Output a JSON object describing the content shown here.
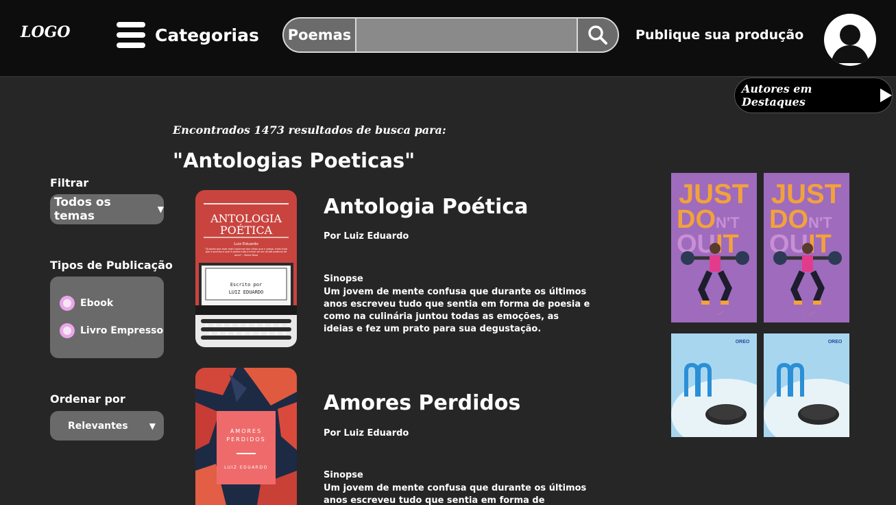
{
  "header": {
    "logo": "LOGO",
    "categories_label": "Categorias",
    "search_type": "Poemas",
    "search_value": "",
    "publish_label": "Publique sua produção"
  },
  "featured_authors_label": "Autores em Destaques",
  "sidebar": {
    "filter_label": "Filtrar",
    "filter_value": "Todos os temas",
    "types_label": "Tipos de Publicação",
    "types": [
      "Ebook",
      "Livro Empresso"
    ],
    "order_label": "Ordenar por",
    "order_value": "Relevantes"
  },
  "results": {
    "found_text": "Encontrados 1473 resultados de busca para:",
    "query": "\"Antologias Poeticas\"",
    "books": [
      {
        "title": "Antologia Poética",
        "author": "Por Luiz Eduardo",
        "synopsis_label": "Sinopse",
        "synopsis": "Um jovem de mente confusa que durante os últimos anos escreveu tudo que sentia em forma de poesia e como na culinária juntou todas as emoções, as ideias e fez um prato para sua degustação.",
        "cover": {
          "title_line1": "ANTOLOGIA",
          "title_line2": "POÉTICA",
          "subtitle": "Luiz Eduardo",
          "quote": "\"Quando que este mais lagrimas dos olhos que n prega, mais tudo que é preciso o que é possa tudo incrivel ao ver ainda poderas de amor\" - Maria Rosa",
          "typed_line1": "Escrito por",
          "typed_line2": "LUIZ EDUARDO"
        }
      },
      {
        "title": "Amores Perdidos",
        "author": "Por Luiz Eduardo",
        "synopsis_label": "Sinopse",
        "synopsis": "Um jovem de mente confusa que durante os últimos anos escreveu tudo que sentia em forma de",
        "cover": {
          "title_line1": "AMORES",
          "title_line2": "PERDIDOS",
          "author": "LUIZ EDUARDO"
        }
      }
    ]
  },
  "ads": [
    {
      "type": "nike",
      "line1": "JUST",
      "line2": "DO",
      "line2b": "N'T",
      "line3": "QU",
      "line3b": "IT"
    },
    {
      "type": "nike",
      "line1": "JUST",
      "line2": "DO",
      "line2b": "N'T",
      "line3": "QU",
      "line3b": "IT"
    },
    {
      "type": "oreo",
      "brand": "OREO"
    },
    {
      "type": "oreo",
      "brand": "OREO"
    }
  ],
  "colors": {
    "header_bg": "#0d0d0d",
    "page_bg": "#262626",
    "panel_bg": "#6a6a6a",
    "radio_accent": "#e9a7e9",
    "cover1_red": "#c9443f",
    "ad_purple": "#9e6bbd",
    "ad_orange": "#f2a23a",
    "ad_sky": "#a9d6ef"
  }
}
